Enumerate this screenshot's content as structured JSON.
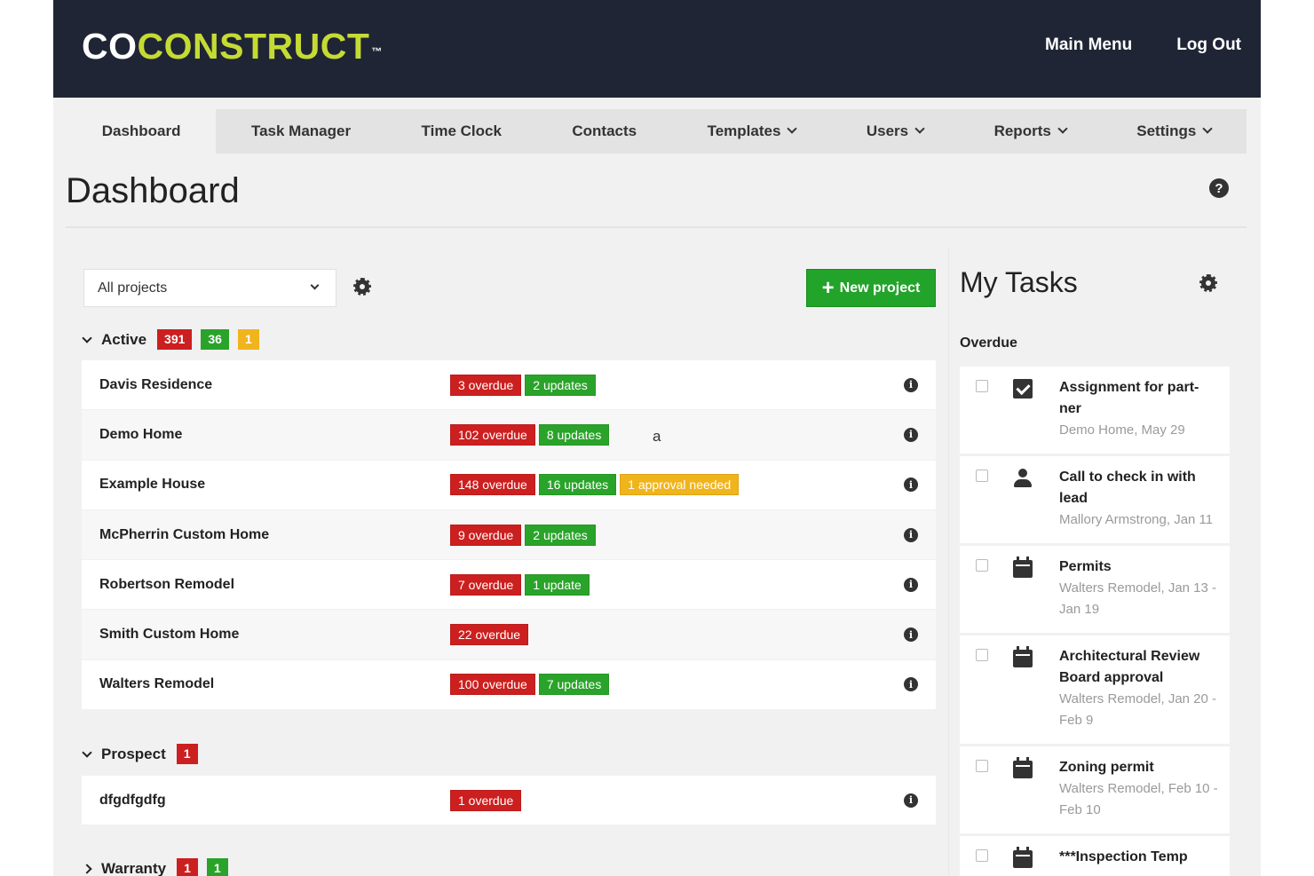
{
  "header": {
    "logo_white": "CO",
    "logo_green": "CONSTRUCT",
    "logo_tm": "™",
    "main_menu": "Main Menu",
    "log_out": "Log Out"
  },
  "nav": [
    {
      "label": "Dashboard",
      "active": true
    },
    {
      "label": "Task Manager"
    },
    {
      "label": "Time Clock"
    },
    {
      "label": "Contacts"
    },
    {
      "label": "Templates",
      "dropdown": true
    },
    {
      "label": "Users",
      "dropdown": true
    },
    {
      "label": "Reports",
      "dropdown": true
    },
    {
      "label": "Settings",
      "dropdown": true
    }
  ],
  "page": {
    "title": "Dashboard",
    "help": "?"
  },
  "filter": {
    "selected": "All projects"
  },
  "new_project": {
    "plus": "+",
    "label": "New project"
  },
  "stray_text": "a",
  "groups": {
    "active": {
      "label": "Active",
      "counts": [
        "391",
        "36",
        "1"
      ]
    },
    "prospect": {
      "label": "Prospect",
      "counts": [
        "1"
      ]
    },
    "warranty": {
      "label": "Warranty",
      "counts": [
        "1",
        "1"
      ]
    }
  },
  "projects_active": [
    {
      "name": "Davis Residence",
      "badges": [
        {
          "text": "3 overdue",
          "color": "red"
        },
        {
          "text": "2 updates",
          "color": "green"
        }
      ]
    },
    {
      "name": "Demo Home",
      "badges": [
        {
          "text": "102 overdue",
          "color": "red"
        },
        {
          "text": "8 updates",
          "color": "green"
        }
      ]
    },
    {
      "name": "Example House",
      "badges": [
        {
          "text": "148 overdue",
          "color": "red"
        },
        {
          "text": "16 updates",
          "color": "green"
        },
        {
          "text": "1 approval needed",
          "color": "yellow"
        }
      ]
    },
    {
      "name": "McPherrin Custom Home",
      "badges": [
        {
          "text": "9 overdue",
          "color": "red"
        },
        {
          "text": "2 updates",
          "color": "green"
        }
      ]
    },
    {
      "name": "Robertson Remodel",
      "badges": [
        {
          "text": "7 overdue",
          "color": "red"
        },
        {
          "text": "1 update",
          "color": "green"
        }
      ]
    },
    {
      "name": "Smith Custom Home",
      "badges": [
        {
          "text": "22 overdue",
          "color": "red"
        }
      ]
    },
    {
      "name": "Walters Remodel",
      "badges": [
        {
          "text": "100 overdue",
          "color": "red"
        },
        {
          "text": "7 updates",
          "color": "green"
        }
      ]
    }
  ],
  "projects_prospect": [
    {
      "name": "dfgdfgdfg",
      "badges": [
        {
          "text": "1 overdue",
          "color": "red"
        }
      ]
    }
  ],
  "tasks": {
    "title": "My Tasks",
    "section": "Overdue",
    "items": [
      {
        "icon": "checked",
        "name": "Assignment for part-ner",
        "meta": "Demo Home, May 29"
      },
      {
        "icon": "person",
        "name": "Call to check in with lead",
        "meta": "Mallory Armstrong, Jan 11"
      },
      {
        "icon": "calendar",
        "name": "Permits",
        "meta": "Walters Remodel, Jan 13 - Jan 19"
      },
      {
        "icon": "calendar",
        "name": "Architectural Review Board approval",
        "meta": "Walters Remodel, Jan 20 - Feb 9"
      },
      {
        "icon": "calendar",
        "name": "Zoning permit",
        "meta": "Walters Remodel, Feb 10 - Feb 10"
      },
      {
        "icon": "calendar",
        "name": "***Inspection Temp",
        "meta": ""
      }
    ]
  },
  "colors": {
    "header_bg": "#1f2535",
    "brand_green": "#c5db34",
    "red": "#cc1f1f",
    "green": "#2aa32a",
    "yellow": "#f0b41c"
  }
}
